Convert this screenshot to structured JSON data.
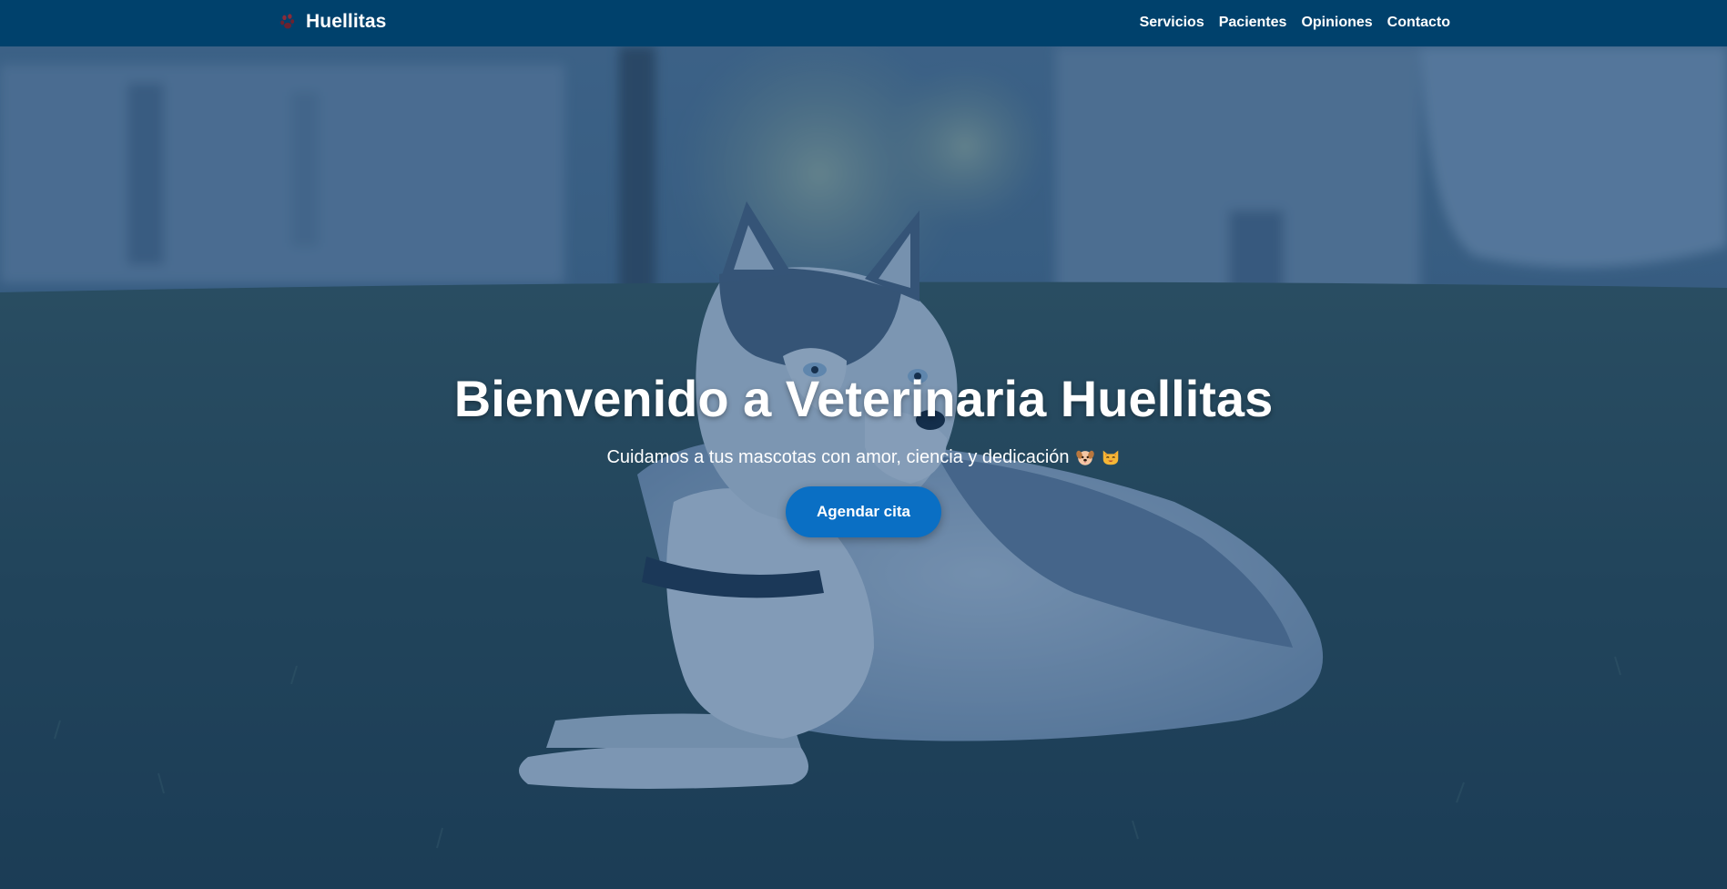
{
  "navbar": {
    "brand": {
      "icon": "paw-icon",
      "name": "Huellitas"
    },
    "links": [
      {
        "label": "Servicios"
      },
      {
        "label": "Pacientes"
      },
      {
        "label": "Opiniones"
      },
      {
        "label": "Contacto"
      }
    ]
  },
  "hero": {
    "background": "husky-dog-lying-on-grass-photo",
    "title": "Bienvenido a Veterinaria Huellitas",
    "subtitle": "Cuidamos a tus mascotas con amor, ciencia y dedicación",
    "subtitle_icons": [
      "dog-face-icon",
      "cat-face-icon"
    ],
    "cta_label": "Agendar cita"
  },
  "colors": {
    "navbar_bg": "#00416c",
    "cta_bg": "#0a6fc4",
    "text": "#ffffff"
  }
}
